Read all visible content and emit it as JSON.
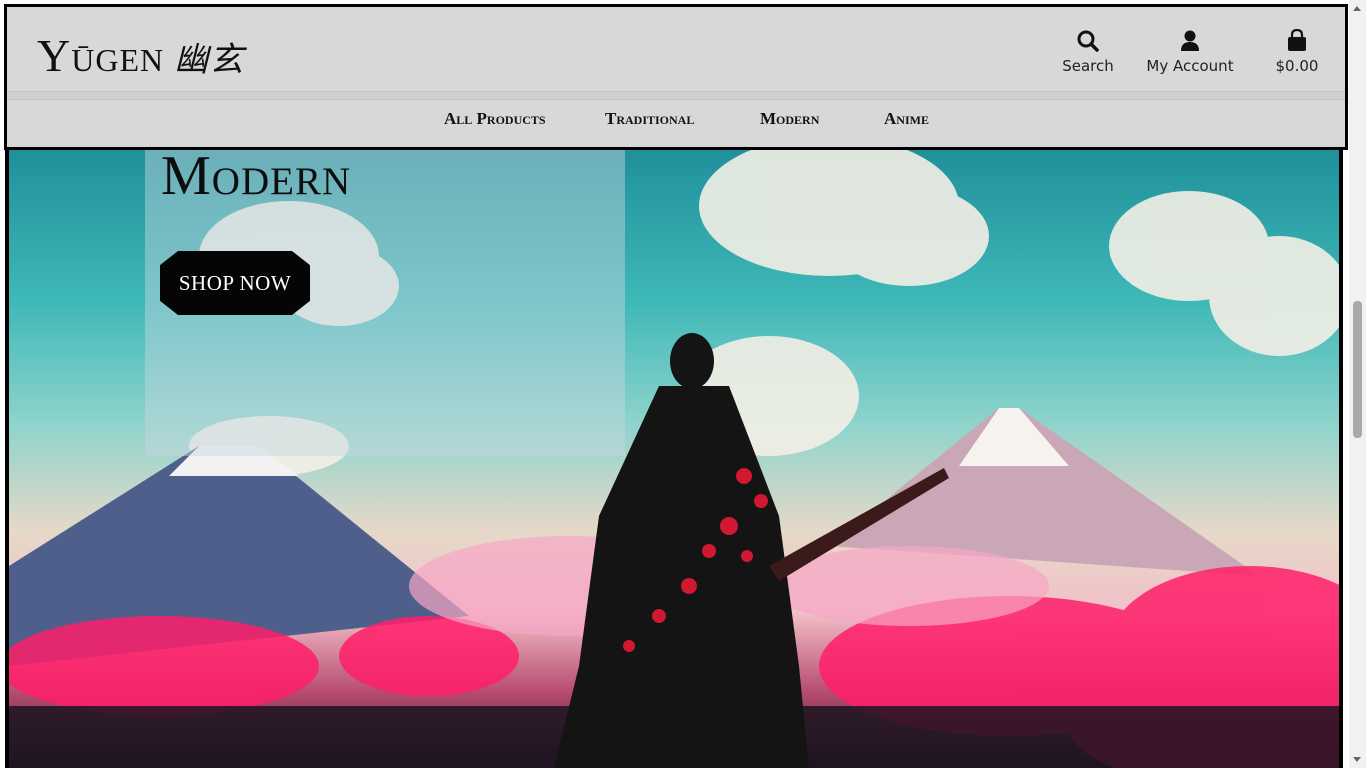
{
  "brand": {
    "name": "Yūgen",
    "kanji": "幽玄"
  },
  "utility": {
    "search_label": "Search",
    "account_label": "My Account",
    "cart_total": "$0.00"
  },
  "nav": {
    "items": [
      {
        "label": "All Products"
      },
      {
        "label": "Traditional"
      },
      {
        "label": "Modern"
      },
      {
        "label": "Anime"
      }
    ]
  },
  "hero": {
    "heading": "Modern",
    "cta_label": "SHOP NOW"
  },
  "colors": {
    "header_bg": "#d6d6d8",
    "button_bg": "#050505",
    "button_text": "#ffffff",
    "border": "#000000"
  },
  "icons": [
    "search-icon",
    "user-icon",
    "shopping-bag-icon"
  ]
}
